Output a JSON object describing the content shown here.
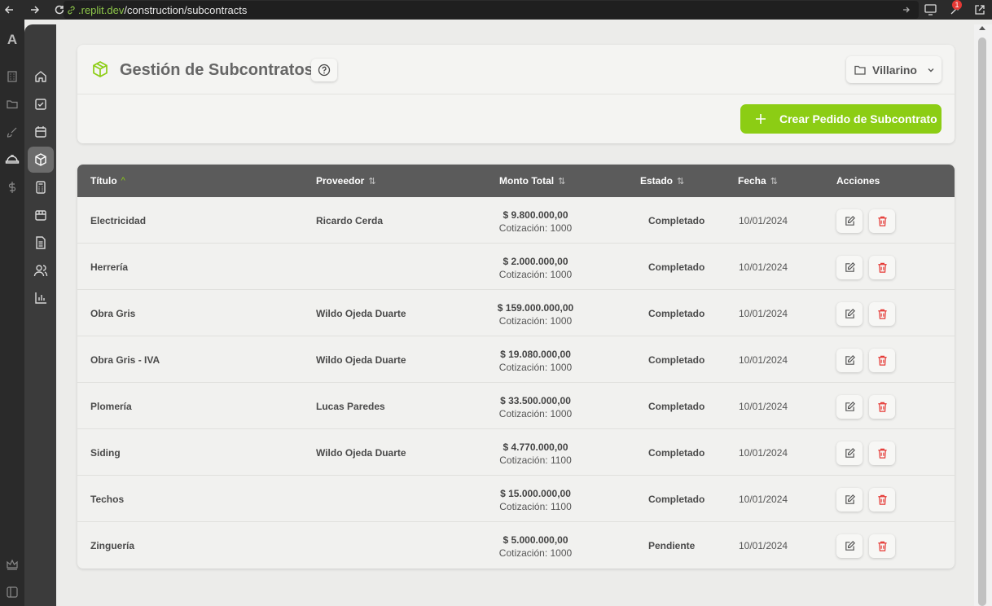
{
  "browser": {
    "url_host": ".replit.dev",
    "url_path": "/construction/subcontracts",
    "notification_count": "1"
  },
  "rail": {
    "logo": "A"
  },
  "header": {
    "title": "Gestión de Subcontratos",
    "project": "Villarino",
    "create_button": "Crear Pedido de Subcontrato"
  },
  "table": {
    "columns": [
      "Título",
      "Proveedor",
      "Monto Total",
      "Estado",
      "Fecha",
      "Acciones"
    ],
    "rows": [
      {
        "titulo": "Electricidad",
        "proveedor": "Ricardo Cerda",
        "monto": "$ 9.800.000,00",
        "cotizacion": "Cotización: 1000",
        "estado": "Completado",
        "fecha": "10/01/2024"
      },
      {
        "titulo": "Herrería",
        "proveedor": "",
        "monto": "$ 2.000.000,00",
        "cotizacion": "Cotización: 1000",
        "estado": "Completado",
        "fecha": "10/01/2024"
      },
      {
        "titulo": "Obra Gris",
        "proveedor": "Wildo Ojeda Duarte",
        "monto": "$ 159.000.000,00",
        "cotizacion": "Cotización: 1000",
        "estado": "Completado",
        "fecha": "10/01/2024"
      },
      {
        "titulo": "Obra Gris - IVA",
        "proveedor": "Wildo Ojeda Duarte",
        "monto": "$ 19.080.000,00",
        "cotizacion": "Cotización: 1000",
        "estado": "Completado",
        "fecha": "10/01/2024"
      },
      {
        "titulo": "Plomería",
        "proveedor": "Lucas Paredes",
        "monto": "$ 33.500.000,00",
        "cotizacion": "Cotización: 1000",
        "estado": "Completado",
        "fecha": "10/01/2024"
      },
      {
        "titulo": "Siding",
        "proveedor": "Wildo Ojeda Duarte",
        "monto": "$ 4.770.000,00",
        "cotizacion": "Cotización: 1100",
        "estado": "Completado",
        "fecha": "10/01/2024"
      },
      {
        "titulo": "Techos",
        "proveedor": "",
        "monto": "$ 15.000.000,00",
        "cotizacion": "Cotización: 1100",
        "estado": "Completado",
        "fecha": "10/01/2024"
      },
      {
        "titulo": "Zinguería",
        "proveedor": "",
        "monto": "$ 5.000.000,00",
        "cotizacion": "Cotización: 1000",
        "estado": "Pendiente",
        "fecha": "10/01/2024"
      }
    ]
  },
  "colors": {
    "accent": "#8ccd14",
    "delete": "#e53935",
    "header_bg": "#5b5b5b"
  },
  "icons": {
    "rail": [
      "building-icon",
      "folder-icon",
      "brush-icon",
      "hardhat-icon",
      "dollar-icon",
      "crown-icon",
      "sidebar-toggle-icon"
    ],
    "nav": [
      "home-icon",
      "checkbox-icon",
      "calendar-icon",
      "box-icon",
      "calculator-icon",
      "package-icon",
      "document-icon",
      "users-icon",
      "bar-chart-icon"
    ]
  }
}
